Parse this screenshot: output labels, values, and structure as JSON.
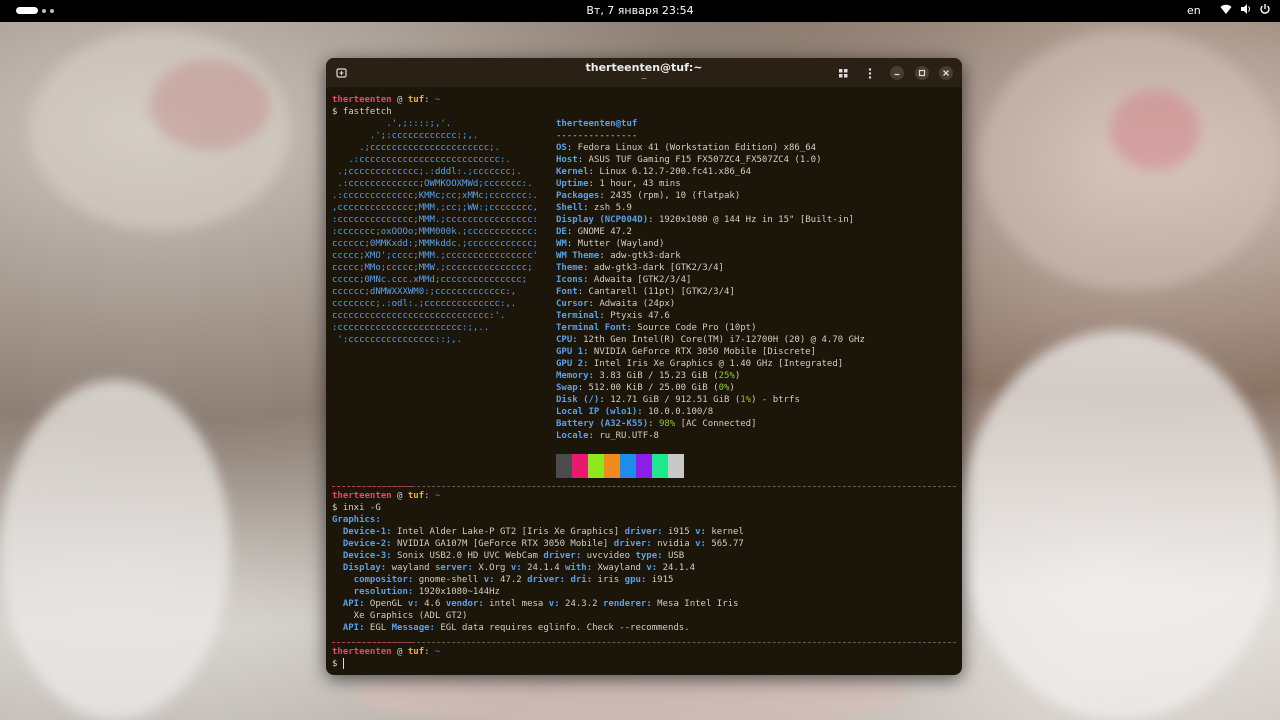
{
  "topbar": {
    "clock": "Вт, 7 января  23:54",
    "lang": "en",
    "wifi_icon": "wifi-icon",
    "volume_icon": "volume-icon",
    "power_icon": "power-icon"
  },
  "window": {
    "title": "therteenten@tuf:~",
    "subtitle": "~",
    "new_tab_icon": "new-tab-icon",
    "grid_icon": "grid-icon",
    "menu_icon": "kebab-menu-icon",
    "minimize_icon": "minimize-icon",
    "maximize_icon": "maximize-icon",
    "close_icon": "close-icon"
  },
  "prompt": {
    "user": "therteenten",
    "at": "@",
    "host": "tuf",
    "colon": ":",
    "path": "~",
    "dollar": "$"
  },
  "commands": [
    "fastfetch",
    "inxi -G"
  ],
  "logo_lines": [
    "          .',;::::;,'.",
    "       .';:cccccccccccc:;,.",
    "     .;cccccccccccccccccccccc;.",
    "   .:cccccccccccccccccccccccccc:.",
    " .;ccccccccccccc;.:dddl:.;ccccccc;.",
    " .:ccccccccccccc;OWMKOOXMWd;ccccccc:.",
    ".:ccccccccccccc;KMMc;cc;xMMc;ccccccc:.",
    ",cccccccccccccc;MMM.;cc;;WW:;cccccccc,",
    ":cccccccccccccc;MMM.;cccccccccccccccc:",
    ":ccccccc;oxOOOo;MMM000k.;cccccccccccc:",
    "cccccc;0MMKxdd:;MMMkddc.;cccccccccccc;",
    "ccccc;XMO';cccc;MMM.;cccccccccccccccc'",
    "ccccc;MMo;ccccc;MMW.;ccccccccccccccc;",
    "ccccc;0MNc.ccc.xMMd;ccccccccccccccc;",
    "cccccc;dNMWXXXWM0:;ccccccccccccc:,",
    "cccccccc;.:odl:.;cccccccccccccc:,.",
    "ccccccccccccccccccccccccccccc:'.",
    ":ccccccccccccccccccccccc:;,..",
    " ':cccccccccccccccc::;,."
  ],
  "info_header": "therteenten@tuf",
  "info_rule": "---------------",
  "info": [
    {
      "k": "OS",
      "v": ": Fedora Linux 41 (Workstation Edition) x86_64"
    },
    {
      "k": "Host",
      "v": ": ASUS TUF Gaming F15 FX507ZC4_FX507ZC4 (1.0)"
    },
    {
      "k": "Kernel",
      "v": ": Linux 6.12.7-200.fc41.x86_64"
    },
    {
      "k": "Uptime",
      "v": ": 1 hour, 43 mins"
    },
    {
      "k": "Packages",
      "v": ": 2435 (rpm), 10 (flatpak)"
    },
    {
      "k": "Shell",
      "v": ": zsh 5.9"
    },
    {
      "k": "Display (NCP004D)",
      "v": ": 1920x1080 @ 144 Hz in 15\" [Built-in]"
    },
    {
      "k": "DE",
      "v": ": GNOME 47.2"
    },
    {
      "k": "WM",
      "v": ": Mutter (Wayland)"
    },
    {
      "k": "WM Theme",
      "v": ": adw-gtk3-dark"
    },
    {
      "k": "Theme",
      "v": ": adw-gtk3-dark [GTK2/3/4]"
    },
    {
      "k": "Icons",
      "v": ": Adwaita [GTK2/3/4]"
    },
    {
      "k": "Font",
      "v": ": Cantarell (11pt) [GTK2/3/4]"
    },
    {
      "k": "Cursor",
      "v": ": Adwaita (24px)"
    },
    {
      "k": "Terminal",
      "v": ": Ptyxis 47.6"
    },
    {
      "k": "Terminal Font",
      "v": ": Source Code Pro (10pt)"
    },
    {
      "k": "CPU",
      "v": ": 12th Gen Intel(R) Core(TM) i7-12700H (20) @ 4.70 GHz"
    },
    {
      "k": "GPU 1",
      "v": ": NVIDIA GeForce RTX 3050 Mobile [Discrete]"
    },
    {
      "k": "GPU 2",
      "v": ": Intel Iris Xe Graphics @ 1.40 GHz [Integrated]"
    },
    {
      "k": "Memory",
      "v": ": 3.83 GiB / 15.23 GiB (",
      "p": "25%",
      "t": ")"
    },
    {
      "k": "Swap",
      "v": ": 512.00 KiB / 25.00 GiB (",
      "p": "0%",
      "t": ")"
    },
    {
      "k": "Disk (/)",
      "v": ": 12.71 GiB / 912.51 GiB (",
      "p": "1%",
      "t": ") - btrfs"
    },
    {
      "k": "Local IP (wlo1)",
      "v": ": 10.0.0.100/8"
    },
    {
      "k": "Battery (A32-K55)",
      "v": ": ",
      "p": "98%",
      "t": " [AC Connected]"
    },
    {
      "k": "Locale",
      "v": ": ru_RU.UTF-8"
    }
  ],
  "palette": [
    "#4b4b4b",
    "#e8196e",
    "#8fe81e",
    "#f08c1e",
    "#1e8ce8",
    "#8c1ee8",
    "#1ee88c",
    "#c8c8c8"
  ],
  "inxi": {
    "graphics": "Graphics:",
    "lines": [
      [
        {
          "g": "  Device-1:"
        },
        {
          "t": " Intel Alder Lake-P GT2 [Iris Xe Graphics] "
        },
        {
          "g": "driver:"
        },
        {
          "t": " i915 "
        },
        {
          "g": "v:"
        },
        {
          "t": " kernel"
        }
      ],
      [
        {
          "g": "  Device-2:"
        },
        {
          "t": " NVIDIA GA107M [GeForce RTX 3050 Mobile] "
        },
        {
          "g": "driver:"
        },
        {
          "t": " nvidia "
        },
        {
          "g": "v:"
        },
        {
          "t": " 565.77"
        }
      ],
      [
        {
          "g": "  Device-3:"
        },
        {
          "t": " Sonix USB2.0 HD UVC WebCam "
        },
        {
          "g": "driver:"
        },
        {
          "t": " uvcvideo "
        },
        {
          "g": "type:"
        },
        {
          "t": " USB"
        }
      ],
      [
        {
          "g": "  Display:"
        },
        {
          "t": " wayland "
        },
        {
          "g": "server:"
        },
        {
          "t": " X.Org "
        },
        {
          "g": "v:"
        },
        {
          "t": " 24.1.4 "
        },
        {
          "g": "with:"
        },
        {
          "t": " Xwayland "
        },
        {
          "g": "v:"
        },
        {
          "t": " 24.1.4"
        }
      ],
      [
        {
          "g": "    compositor:"
        },
        {
          "t": " gnome-shell "
        },
        {
          "g": "v:"
        },
        {
          "t": " 47.2 "
        },
        {
          "g": "driver:"
        },
        {
          "t": " "
        },
        {
          "g": "dri:"
        },
        {
          "t": " iris "
        },
        {
          "g": "gpu:"
        },
        {
          "t": " i915"
        }
      ],
      [
        {
          "g": "    resolution:"
        },
        {
          "t": " 1920x1080~144Hz"
        }
      ],
      [
        {
          "g": "  API:"
        },
        {
          "t": " OpenGL "
        },
        {
          "g": "v:"
        },
        {
          "t": " 4.6 "
        },
        {
          "g": "vendor:"
        },
        {
          "t": " intel mesa "
        },
        {
          "g": "v:"
        },
        {
          "t": " 24.3.2 "
        },
        {
          "g": "renderer:"
        },
        {
          "t": " Mesa Intel Iris"
        }
      ],
      [
        {
          "t": "    Xe Graphics (ADL GT2)"
        }
      ],
      [
        {
          "g": "  API:"
        },
        {
          "t": " EGL "
        },
        {
          "g": "Message:"
        },
        {
          "t": " EGL data requires eglinfo. Check --recommends."
        }
      ]
    ]
  }
}
